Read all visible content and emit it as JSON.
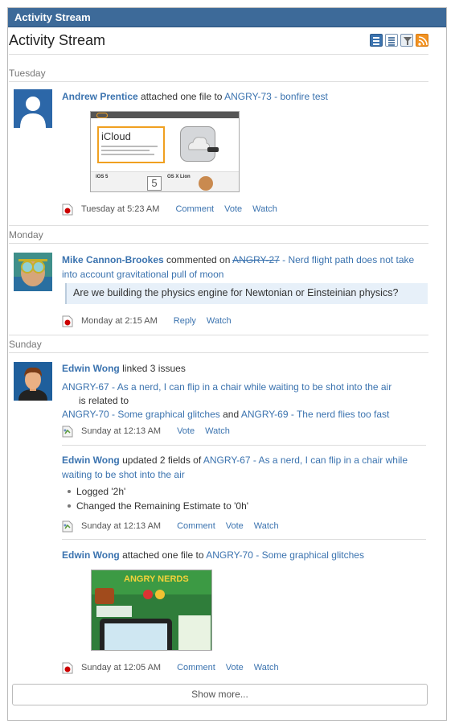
{
  "gadget_title": "Activity Stream",
  "header": {
    "title": "Activity Stream"
  },
  "days": [
    "Tuesday",
    "Monday",
    "Sunday"
  ],
  "e1": {
    "user": "Andrew Prentice",
    "verb": "attached one file to",
    "link": "ANGRY-73 - bonfire test",
    "time": "Tuesday at 5:23 AM",
    "a1": "Comment",
    "a2": "Vote",
    "a3": "Watch",
    "thumb": {
      "title": "iCloud",
      "b1": "iOS 5",
      "b2": "OS X Lion",
      "num": "5"
    }
  },
  "e2": {
    "user": "Mike Cannon-Brookes",
    "verb": "commented on",
    "key": "ANGRY-27",
    "summary": " - Nerd flight path does not take into account gravitational pull of moon",
    "quote": "Are we building the physics engine for Newtonian or Einsteinian physics?",
    "time": "Monday at 2:15 AM",
    "a1": "Reply",
    "a2": "Watch"
  },
  "e3": {
    "user": "Edwin Wong",
    "verb": "linked 3 issues",
    "l1": "ANGRY-67 - As a nerd, I can flip in a chair while waiting to be shot into the air",
    "rel": "is related to",
    "l2": "ANGRY-70 - Some graphical glitches",
    "and": "and",
    "l3": "ANGRY-69 - The nerd flies too fast",
    "time": "Sunday at 12:13 AM",
    "a1": "Vote",
    "a2": "Watch"
  },
  "e4": {
    "user": "Edwin Wong",
    "verb": "updated 2 fields of",
    "link": "ANGRY-67 - As a nerd, I can flip in a chair while waiting to be shot into the air",
    "b1": "Logged '2h'",
    "b2": "Changed the Remaining Estimate to '0h'",
    "time": "Sunday at 12:13 AM",
    "a1": "Comment",
    "a2": "Vote",
    "a3": "Watch"
  },
  "e5": {
    "user": "Edwin Wong",
    "verb": "attached one file to",
    "link": "ANGRY-70 - Some graphical glitches",
    "time": "Sunday at 12:05 AM",
    "a1": "Comment",
    "a2": "Vote",
    "a3": "Watch",
    "thumb": {
      "title": "ANGRY NERDS"
    }
  },
  "show_more": "Show more..."
}
